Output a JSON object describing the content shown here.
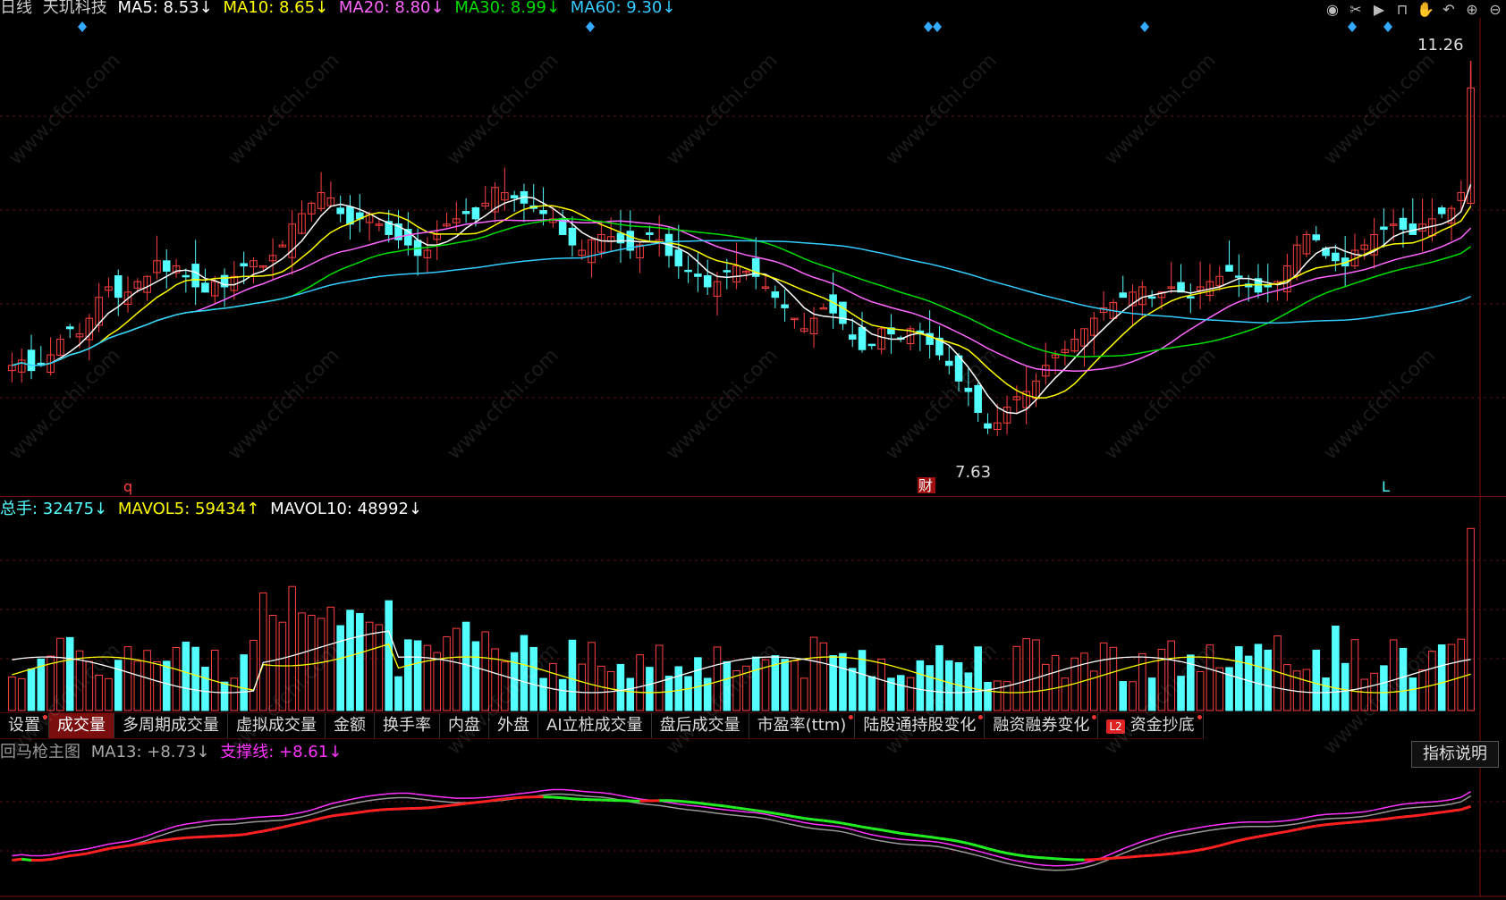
{
  "top_bar": {
    "period": "日线",
    "stock_name": "天玑科技",
    "ma5": "MA5: 8.53↓",
    "ma10": "MA10: 8.65↓",
    "ma20": "MA20: 8.80↓",
    "ma30": "MA30: 8.99↓",
    "ma60": "MA60: 9.30↓"
  },
  "toolbar_icons": [
    "eye-icon",
    "scissors-icon",
    "play-icon",
    "lock-icon",
    "hand-icon",
    "undo-icon",
    "zoom-in-icon",
    "zoom-out-icon"
  ],
  "price_panel": {
    "high_label": "11.26",
    "low_label": "7.63",
    "marker_left": "q",
    "marker_cai": "财",
    "marker_right": "L"
  },
  "volume_bar": {
    "total": "总手: 32475↓",
    "mavol5": "MAVOL5: 59434↑",
    "mavol10": "MAVOL10: 48992↓"
  },
  "tabs": [
    {
      "label": "设置",
      "dot": true
    },
    {
      "label": "成交量",
      "active": true
    },
    {
      "label": "多周期成交量"
    },
    {
      "label": "虚拟成交量"
    },
    {
      "label": "金额"
    },
    {
      "label": "换手率"
    },
    {
      "label": "内盘"
    },
    {
      "label": "外盘"
    },
    {
      "label": "AI立桩成交量"
    },
    {
      "label": "盘后成交量"
    },
    {
      "label": "市盈率(ttm)",
      "dot": true
    },
    {
      "label": "陆股通持股变化",
      "dot": true
    },
    {
      "label": "融资融券变化",
      "dot": true
    },
    {
      "label": "资金抄底",
      "dot": true,
      "badge": "L2"
    }
  ],
  "indicator_bar": {
    "name": "回马枪主图",
    "ma13": "MA13: +8.73↓",
    "support": "支撑线: +8.61↓"
  },
  "indicator_button": "指标说明",
  "watermark": "www.cfchi.com",
  "colors": {
    "up": "#ff4040",
    "down": "#54ffff",
    "ma5": "#ffffff",
    "ma10": "#ffff00",
    "ma20": "#ff66ff",
    "ma30": "#00dd00",
    "ma60": "#33ccff"
  },
  "chart_data": {
    "type": "candlestick",
    "title": "天玑科技 日线",
    "price_range": [
      7.4,
      11.5
    ],
    "high": 11.26,
    "low": 7.63,
    "closes": [
      8.35,
      8.4,
      8.3,
      8.35,
      8.45,
      8.6,
      8.7,
      8.65,
      8.8,
      9.0,
      9.1,
      9.0,
      9.05,
      9.15,
      9.2,
      9.35,
      9.25,
      9.3,
      9.2,
      9.1,
      9.05,
      9.15,
      9.1,
      9.2,
      9.3,
      9.35,
      9.3,
      9.4,
      9.5,
      9.7,
      9.8,
      9.9,
      10.0,
      9.95,
      9.8,
      9.7,
      9.75,
      9.8,
      9.7,
      9.6,
      9.55,
      9.5,
      9.4,
      9.45,
      9.6,
      9.7,
      9.75,
      9.8,
      9.75,
      9.9,
      10.05,
      10.0,
      9.95,
      9.9,
      9.85,
      9.8,
      9.75,
      9.6,
      9.5,
      9.45,
      9.55,
      9.6,
      9.58,
      9.52,
      9.45,
      9.5,
      9.6,
      9.55,
      9.4,
      9.3,
      9.25,
      9.2,
      9.1,
      9.15,
      9.25,
      9.3,
      9.25,
      9.2,
      9.1,
      9.0,
      8.9,
      8.8,
      8.7,
      8.8,
      8.9,
      8.85,
      8.75,
      8.6,
      8.5,
      8.55,
      8.7,
      8.65,
      8.6,
      8.7,
      8.65,
      8.55,
      8.45,
      8.35,
      8.2,
      8.1,
      7.9,
      7.75,
      7.8,
      7.95,
      8.05,
      8.1,
      8.2,
      8.35,
      8.45,
      8.5,
      8.6,
      8.7,
      8.8,
      8.9,
      8.95,
      9.0,
      9.05,
      9.1,
      9.0,
      9.05,
      9.1,
      9.05,
      9.0,
      9.1,
      9.15,
      9.2,
      9.25,
      9.2,
      9.1,
      9.05,
      9.1,
      9.15,
      9.3,
      9.5,
      9.6,
      9.55,
      9.4,
      9.35,
      9.3,
      9.45,
      9.5,
      9.6,
      9.65,
      9.7,
      9.65,
      9.6,
      9.7,
      9.75,
      9.8,
      9.85,
      10.0,
      11.0
    ],
    "ma_series": [
      {
        "name": "MA5",
        "value": 8.53
      },
      {
        "name": "MA10",
        "value": 8.65
      },
      {
        "name": "MA20",
        "value": 8.8
      },
      {
        "name": "MA30",
        "value": 8.99
      },
      {
        "name": "MA60",
        "value": 9.3
      }
    ],
    "volume": {
      "total": 32475,
      "mavol5": 59434,
      "mavol10": 48992
    }
  }
}
